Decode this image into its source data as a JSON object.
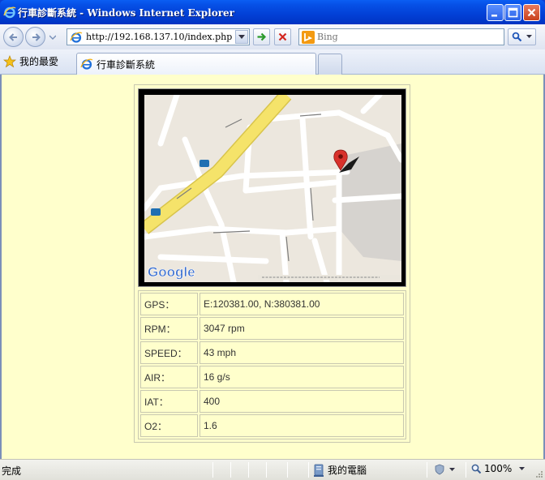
{
  "window": {
    "title": "行車診斷系統 - Windows Internet Explorer"
  },
  "navbar": {
    "address": "http://192.168.137.10/index.php",
    "search_placeholder": "Bing"
  },
  "favorites": {
    "label": "我的最愛"
  },
  "tab": {
    "label": "行車診斷系統"
  },
  "map": {
    "provider_logo": "Google"
  },
  "vehicle_data": [
    {
      "label": "GPS：",
      "value": "E:120381.00, N:380381.00"
    },
    {
      "label": "RPM：",
      "value": "3047 rpm"
    },
    {
      "label": "SPEED：",
      "value": "43 mph"
    },
    {
      "label": "AIR：",
      "value": "16 g/s"
    },
    {
      "label": "IAT：",
      "value": "400"
    },
    {
      "label": "O2：",
      "value": "1.6"
    }
  ],
  "status": {
    "text": "完成",
    "zone": "我的電腦",
    "zoom": "100%"
  },
  "colors": {
    "page_background": "#ffffcc",
    "titlebar": "#0240d6",
    "map_road_major": "#f5e36a",
    "map_marker": "#d8312b"
  }
}
